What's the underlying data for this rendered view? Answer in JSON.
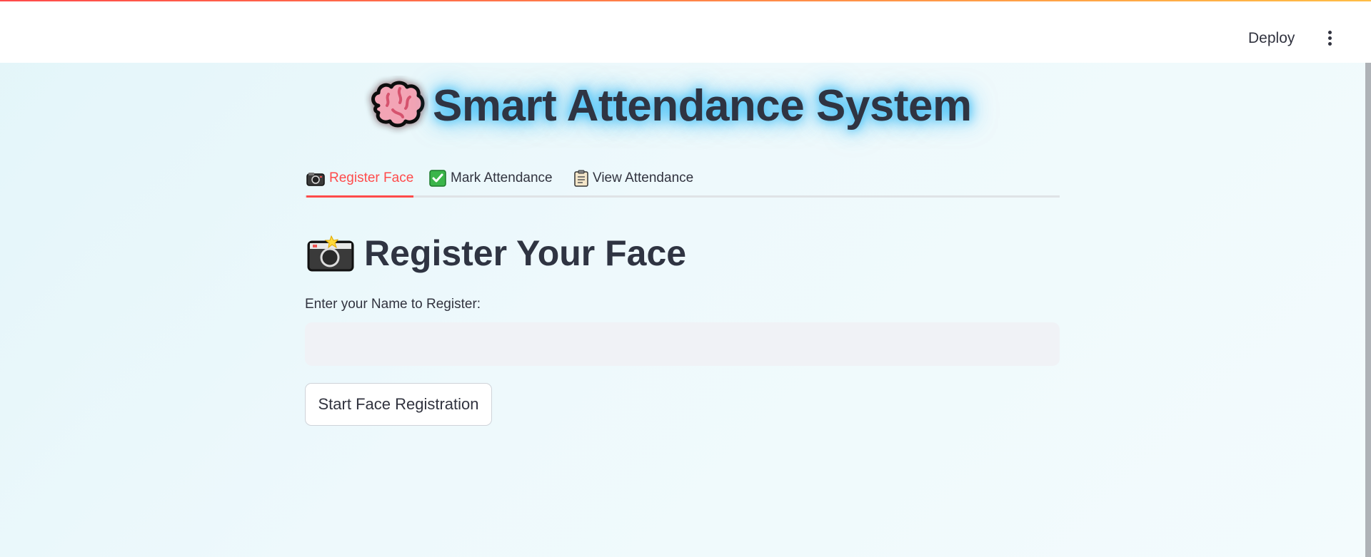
{
  "header": {
    "deploy_label": "Deploy",
    "menu_icon": "kebab-menu-icon"
  },
  "app": {
    "title": "Smart Attendance System",
    "title_icon": "brain-icon",
    "glow_color": "#38bdf8"
  },
  "tabs": [
    {
      "label": "Register Face",
      "icon": "camera-icon",
      "active": true
    },
    {
      "label": "Mark Attendance",
      "icon": "check-mark-icon",
      "active": false
    },
    {
      "label": "View Attendance",
      "icon": "clipboard-icon",
      "active": false
    }
  ],
  "main": {
    "heading": "Register Your Face",
    "heading_icon": "camera-flash-icon",
    "name_label": "Enter your Name to Register:",
    "name_value": "",
    "name_placeholder": "",
    "submit_label": "Start Face Registration"
  },
  "colors": {
    "accent": "#ff4b4b",
    "text": "#31333f",
    "input_bg": "#f0f2f6"
  }
}
